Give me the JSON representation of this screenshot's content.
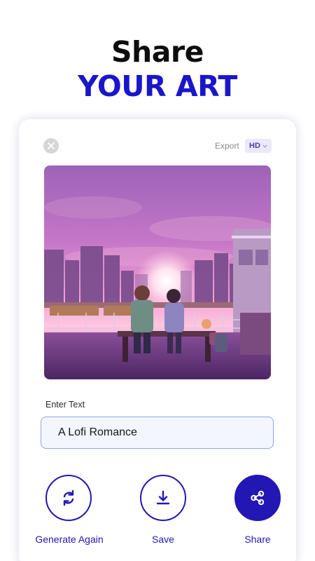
{
  "headline": {
    "line1": "Share",
    "line2": "YOUR ART"
  },
  "card": {
    "close_icon": "close-icon",
    "export_label": "Export",
    "quality_select": {
      "selected": "HD",
      "icon": "chevron-down-icon"
    },
    "artwork": {
      "icon": "lofi-romance-artwork"
    },
    "text_field": {
      "label": "Enter Text",
      "value": "A Lofi Romance"
    },
    "actions": [
      {
        "label": "Generate Again",
        "icon": "refresh-icon"
      },
      {
        "label": "Save",
        "icon": "download-icon"
      },
      {
        "label": "Share",
        "icon": "share-icon"
      }
    ]
  },
  "colors": {
    "accent": "#2217b5",
    "headline_dark": "#0d0d0d",
    "headline_blue": "#1a16c9",
    "input_border": "#8aa7e6",
    "input_bg": "#f3f6fe",
    "hd_bg": "#ece8fb"
  }
}
